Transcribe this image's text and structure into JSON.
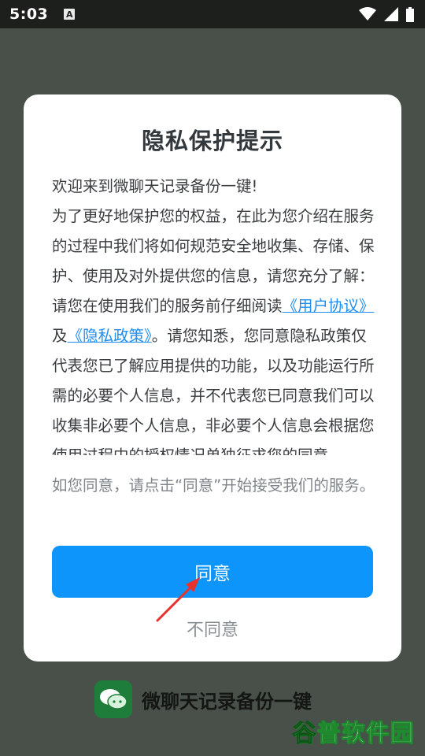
{
  "status_bar": {
    "time": "5:03",
    "notification_icon": "A"
  },
  "dialog": {
    "title": "隐私保护提示",
    "body": {
      "p1": "欢迎来到微聊天记录备份一键!",
      "p2": "为了更好地保护您的权益，在此为您介绍在服务的过程中我们将如何规范安全地收集、存储、保护、使用及对外提供您的信息，请您充分了解：",
      "p3_prefix": "请您在使用我们的服务前仔细阅读",
      "user_agreement_link": "《用户协议》",
      "and": "及",
      "privacy_policy_link": "《隐私政策》",
      "p3_suffix": "。请您知悉，您同意隐私政策仅代表您已了解应用提供的功能，以及功能运行所需的必要个人信息，并不代表您已同意我们可以收集非必要个人信息，非必要个人信息会根据您使用过程中的授权情况单独征求您的同意。"
    },
    "footnote": "如您同意，请点击“同意”开始接受我们的服务。",
    "agree_label": "同意",
    "disagree_label": "不同意"
  },
  "brand": {
    "app_name": "微聊天记录备份一键"
  },
  "watermark": {
    "first_char": "谷",
    "rest": "普软件园"
  },
  "colors": {
    "accent": "#0e95fb",
    "link": "#1e8ef0",
    "annotation_arrow": "#e8322c"
  }
}
